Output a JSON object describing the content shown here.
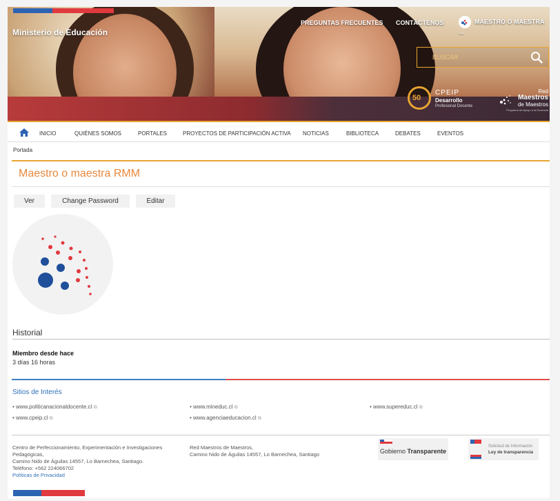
{
  "colors": {
    "blue": "#2d63b3",
    "red": "#e0393e",
    "orange": "#e8a531",
    "title_orange": "#e8883c",
    "link_blue": "#2f6fb4"
  },
  "header": {
    "site_name": "Ministerio de Educación",
    "links": [
      "PREGUNTAS FRECUENTES",
      "CONTÁCTENOS",
      "MAESTRO O MAESTRA ..."
    ],
    "search_placeholder": "BUSCAR",
    "cpeip_logo": {
      "badge": "50",
      "line1": "CPEIP",
      "line2": "Desarrollo",
      "line3": "Profesional Docente"
    },
    "red_maestros_logo": {
      "line1": "Red",
      "line2": "Maestros",
      "line3": "de Maestros",
      "line4": "Programa de Apoyo a la Docencia"
    }
  },
  "nav": [
    "INICIO",
    "QUIÉNES SOMOS",
    "PORTALES",
    "PROYECTOS DE PARTICIPACIÓN ACTIVA",
    "NOTICIAS",
    "BIBLIOTECA",
    "DEBATES",
    "EVENTOS"
  ],
  "breadcrumb": "Portada",
  "page_title": "Maestro o maestra RMM",
  "tabs": [
    "Ver",
    "Change Password",
    "Editar"
  ],
  "history": {
    "heading": "Historial",
    "member_label": "Miembro desde hace",
    "member_value": "3 días 16 horas"
  },
  "sitios": {
    "title": "Sitios de Interés",
    "links": [
      "www.politicanacionaldocente.cl",
      "www.mineduc.cl",
      "www.supereduc.cl",
      "www.cpeip.cl",
      "www.agenciaeducacion.cl"
    ]
  },
  "footer": {
    "col1": [
      "Centro de Perfeccionamiento, Experimentación e Investigaciones",
      "Pedagógicas,",
      "Camino Nido de Águilas 14557, Lo Barnechea, Santiago.",
      "Teléfono: +562 224066702"
    ],
    "privacy": "Políticas de Privacidad",
    "col2": [
      "Red Maestros de Maestros,",
      "Camino Nido de Águilas 14557, Lo Barnechea, Santiago"
    ],
    "gob_transparente": {
      "a": "Gobierno",
      "b": "Transparente"
    },
    "solicitud": {
      "line1": "Solicitud de Información",
      "line2": "Ley de transparencia"
    }
  }
}
